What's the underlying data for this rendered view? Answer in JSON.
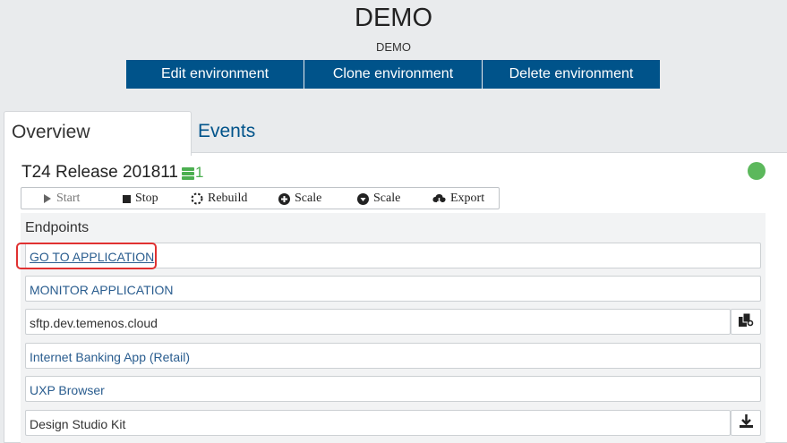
{
  "header": {
    "title": "DEMO",
    "subtitle": "DEMO",
    "buttons": [
      "Edit environment",
      "Clone environment",
      "Delete environment"
    ]
  },
  "tabs": [
    "Overview",
    "Events"
  ],
  "release": {
    "title": "T24 Release 201811",
    "instance_count": "1",
    "status_color": "#5cb85c"
  },
  "actions": [
    "Start",
    "Stop",
    "Rebuild",
    "Scale",
    "Scale",
    "Export"
  ],
  "endpoints": {
    "title": "Endpoints",
    "items": [
      "GO TO APPLICATION",
      "MONITOR APPLICATION",
      "sftp.dev.temenos.cloud",
      "Internet Banking App (Retail)",
      "UXP Browser",
      "Design Studio Kit"
    ]
  },
  "colors": {
    "primary": "#00538a",
    "success": "#4caf50",
    "link": "#2a5d8f",
    "highlight": "#e03131"
  }
}
